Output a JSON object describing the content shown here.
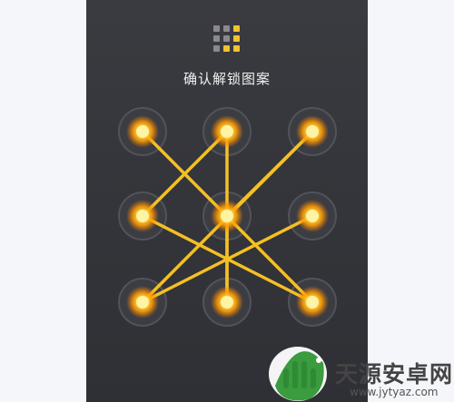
{
  "screen": {
    "title": "确认解锁图案"
  },
  "pattern": {
    "colors": {
      "line": "#f5c023",
      "node_core": "#fff3a4",
      "node_glow": "#ff9d00",
      "ring": "#52535a",
      "background": "#36373c"
    },
    "nodes": [
      {
        "id": 1,
        "active": true
      },
      {
        "id": 2,
        "active": true
      },
      {
        "id": 3,
        "active": true
      },
      {
        "id": 4,
        "active": true
      },
      {
        "id": 5,
        "active": true
      },
      {
        "id": 6,
        "active": true
      },
      {
        "id": 7,
        "active": true
      },
      {
        "id": 8,
        "active": true
      },
      {
        "id": 9,
        "active": true
      }
    ],
    "path": [
      1,
      9,
      4,
      2,
      8,
      5,
      3,
      7,
      6
    ],
    "thumbnail": {
      "cells": [
        "dim",
        "dim",
        "lit",
        "dim",
        "dim",
        "lit",
        "dim",
        "lit",
        "lit"
      ],
      "colors": {
        "lit": "#f2c230",
        "dim": "#8a8a8e"
      }
    }
  },
  "watermark": {
    "name": "天源安卓网",
    "url": "www.jytyaz.com",
    "icon": "android-robot-icon",
    "colors": {
      "green": "#3a9b3f",
      "text": "#444444"
    }
  }
}
